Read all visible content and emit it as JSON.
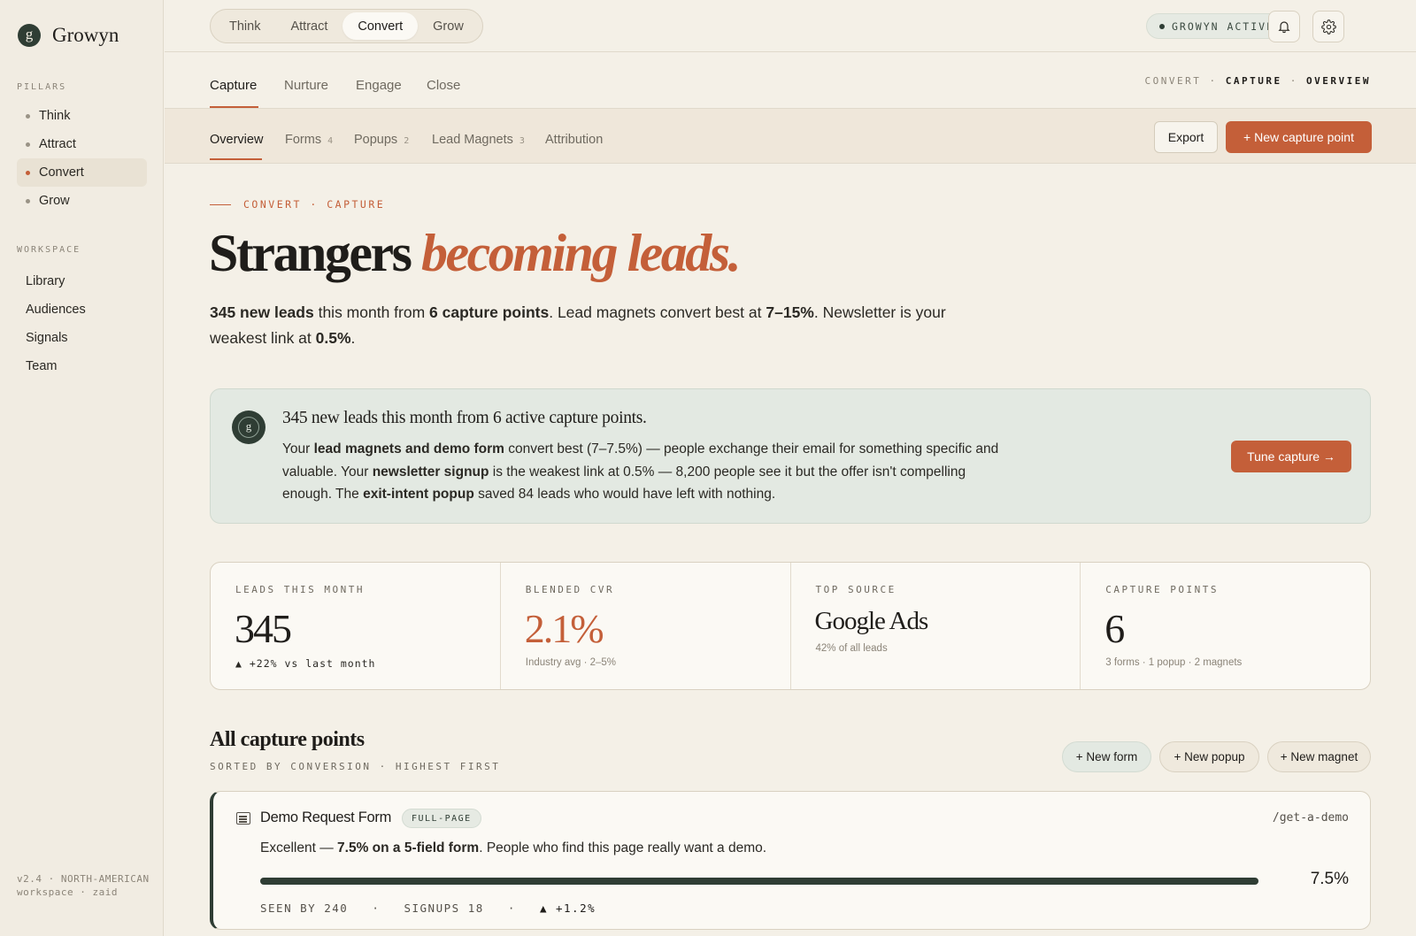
{
  "brand": {
    "mark": "g",
    "name": "Growyn"
  },
  "sidebar": {
    "pillars_label": "PILLARS",
    "pillars": [
      {
        "label": "Think"
      },
      {
        "label": "Attract"
      },
      {
        "label": "Convert",
        "active": true
      },
      {
        "label": "Grow"
      }
    ],
    "workspace_label": "WORKSPACE",
    "workspace": [
      {
        "label": "Library"
      },
      {
        "label": "Audiences"
      },
      {
        "label": "Signals"
      },
      {
        "label": "Team"
      }
    ],
    "footer_line1": "v2.4 · NORTH-AMERICAN",
    "footer_line2": "workspace · zaid"
  },
  "topbar": {
    "pillars": [
      "Think",
      "Attract",
      "Convert",
      "Grow"
    ],
    "active_pillar": "Convert",
    "status": "GROWYN ACTIVE",
    "bell_icon": "bell-icon",
    "settings_icon": "gear-icon"
  },
  "subnav": {
    "tabs": [
      "Capture",
      "Nurture",
      "Engage",
      "Close"
    ],
    "active": "Capture",
    "breadcrumb": [
      "CONVERT",
      "CAPTURE",
      "OVERVIEW"
    ]
  },
  "tertiary": {
    "tabs": [
      {
        "label": "Overview",
        "count": ""
      },
      {
        "label": "Forms",
        "count": "4"
      },
      {
        "label": "Popups",
        "count": "2"
      },
      {
        "label": "Lead Magnets",
        "count": "3"
      },
      {
        "label": "Attribution",
        "count": ""
      }
    ],
    "active": "Overview",
    "export_label": "Export",
    "new_label": "+ New capture point"
  },
  "hero": {
    "eyebrow": "CONVERT · CAPTURE",
    "headline_plain": "Strangers",
    "headline_italic": "becoming leads.",
    "lede": {
      "leads": "345 new leads",
      "t1": " this month from ",
      "points": "6 capture points",
      "t2": ". Lead magnets convert best at ",
      "range": "7–15%",
      "t3": ". Newsletter is your weakest link at ",
      "weak": "0.5%",
      "t4": "."
    }
  },
  "insight": {
    "mark": "g",
    "title": "345 new leads this month from 6 active capture points.",
    "p1": "Your ",
    "b1": "lead magnets and demo form",
    "p2": " convert best (7–7.5%) — people exchange their email for something specific and valuable. Your ",
    "b2": "newsletter signup",
    "p3": " is the weakest link at 0.5% — 8,200 people see it but the offer isn't compelling enough. The ",
    "b3": "exit-intent popup",
    "p4": " saved 84 leads who would have left with nothing.",
    "button": "Tune capture →"
  },
  "stats": [
    {
      "label": "LEADS THIS MONTH",
      "value": "345",
      "sub": "▲ +22% vs last month"
    },
    {
      "label": "BLENDED CVR",
      "value": "2.1%",
      "sub": "Industry avg · 2–5%"
    },
    {
      "label": "TOP SOURCE",
      "value": "Google Ads",
      "sub": "42% of all leads"
    },
    {
      "label": "CAPTURE POINTS",
      "value": "6",
      "sub": "3 forms · 1 popup · 2 magnets"
    }
  ],
  "capture_points": {
    "title": "All capture points",
    "subtitle": "SORTED BY CONVERSION · HIGHEST FIRST",
    "new_form": "+ New form",
    "new_popup": "+ New popup",
    "new_magnet": "+ New magnet",
    "items": [
      {
        "icon": "form-icon",
        "name": "Demo Request Form",
        "tag": "FULL-PAGE",
        "path": "/get-a-demo",
        "desc_pre": "Excellent — ",
        "desc_bold": "7.5% on a 5-field form",
        "desc_post": ". People who find this page really want a demo.",
        "progress": 1.0,
        "rate": "7.5%",
        "seen": "SEEN BY 240",
        "signups": "SIGNUPS 18",
        "trend": "▲ +1.2%"
      }
    ]
  },
  "colors": {
    "accent": "#c45f39",
    "forest": "#2f3d34",
    "background": "#f4f0e7",
    "insight_bg": "#e3e9e2"
  }
}
